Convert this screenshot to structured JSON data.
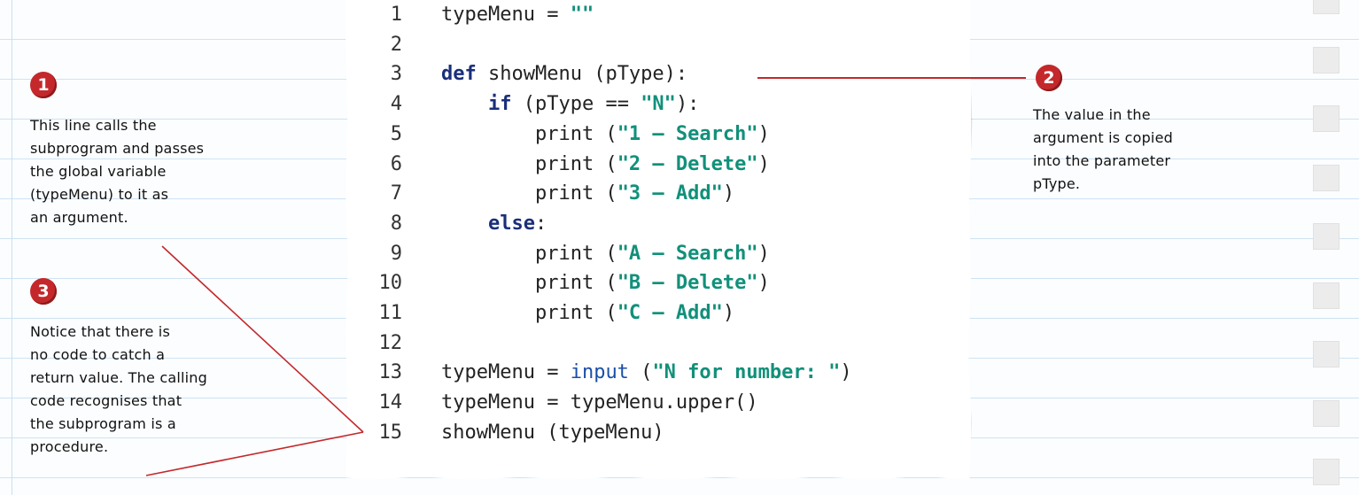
{
  "code": {
    "lines": [
      {
        "n": "1",
        "tokens": [
          {
            "t": "typeMenu = "
          },
          {
            "t": "\"\"",
            "c": "str"
          }
        ]
      },
      {
        "n": "2",
        "tokens": []
      },
      {
        "n": "3",
        "tokens": [
          {
            "t": "def",
            "c": "kw"
          },
          {
            "t": " showMenu (pType):"
          }
        ]
      },
      {
        "n": "4",
        "tokens": [
          {
            "t": "    "
          },
          {
            "t": "if",
            "c": "kw"
          },
          {
            "t": " (pType == "
          },
          {
            "t": "\"N\"",
            "c": "str"
          },
          {
            "t": "):"
          }
        ]
      },
      {
        "n": "5",
        "tokens": [
          {
            "t": "        print ("
          },
          {
            "t": "\"1 – Search\"",
            "c": "str"
          },
          {
            "t": ")"
          }
        ]
      },
      {
        "n": "6",
        "tokens": [
          {
            "t": "        print ("
          },
          {
            "t": "\"2 – Delete\"",
            "c": "str"
          },
          {
            "t": ")"
          }
        ]
      },
      {
        "n": "7",
        "tokens": [
          {
            "t": "        print ("
          },
          {
            "t": "\"3 – Add\"",
            "c": "str"
          },
          {
            "t": ")"
          }
        ]
      },
      {
        "n": "8",
        "tokens": [
          {
            "t": "    "
          },
          {
            "t": "else",
            "c": "kw"
          },
          {
            "t": ":"
          }
        ]
      },
      {
        "n": "9",
        "tokens": [
          {
            "t": "        print ("
          },
          {
            "t": "\"A – Search\"",
            "c": "str"
          },
          {
            "t": ")"
          }
        ]
      },
      {
        "n": "10",
        "tokens": [
          {
            "t": "        print ("
          },
          {
            "t": "\"B – Delete\"",
            "c": "str"
          },
          {
            "t": ")"
          }
        ]
      },
      {
        "n": "11",
        "tokens": [
          {
            "t": "        print ("
          },
          {
            "t": "\"C – Add\"",
            "c": "str"
          },
          {
            "t": ")"
          }
        ]
      },
      {
        "n": "12",
        "tokens": []
      },
      {
        "n": "13",
        "tokens": [
          {
            "t": "typeMenu = "
          },
          {
            "t": "input",
            "c": "fn"
          },
          {
            "t": " ("
          },
          {
            "t": "\"N for number: \"",
            "c": "str"
          },
          {
            "t": ")"
          }
        ]
      },
      {
        "n": "14",
        "tokens": [
          {
            "t": "typeMenu = typeMenu.upper()"
          }
        ]
      },
      {
        "n": "15",
        "tokens": [
          {
            "t": "showMenu (typeMenu)"
          }
        ]
      }
    ]
  },
  "notes": {
    "note1": {
      "badge": "1",
      "lines": [
        "This line calls the",
        "subprogram and passes",
        "the global variable",
        "(typeMenu) to it as",
        "an argument."
      ]
    },
    "note2": {
      "badge": "2",
      "lines": [
        "The value in the",
        "argument is copied",
        "into the parameter",
        "pType."
      ]
    },
    "note3": {
      "badge": "3",
      "lines": [
        "Notice that there is",
        "no code to catch a",
        "return value. The calling",
        "code recognises that",
        "the subprogram is a",
        "procedure."
      ]
    }
  },
  "colors": {
    "keyword": "#1a2f7a",
    "string": "#11907a",
    "badge": "#c4282b",
    "pointer_line": "#c4282b"
  },
  "checkbox_count": 9
}
